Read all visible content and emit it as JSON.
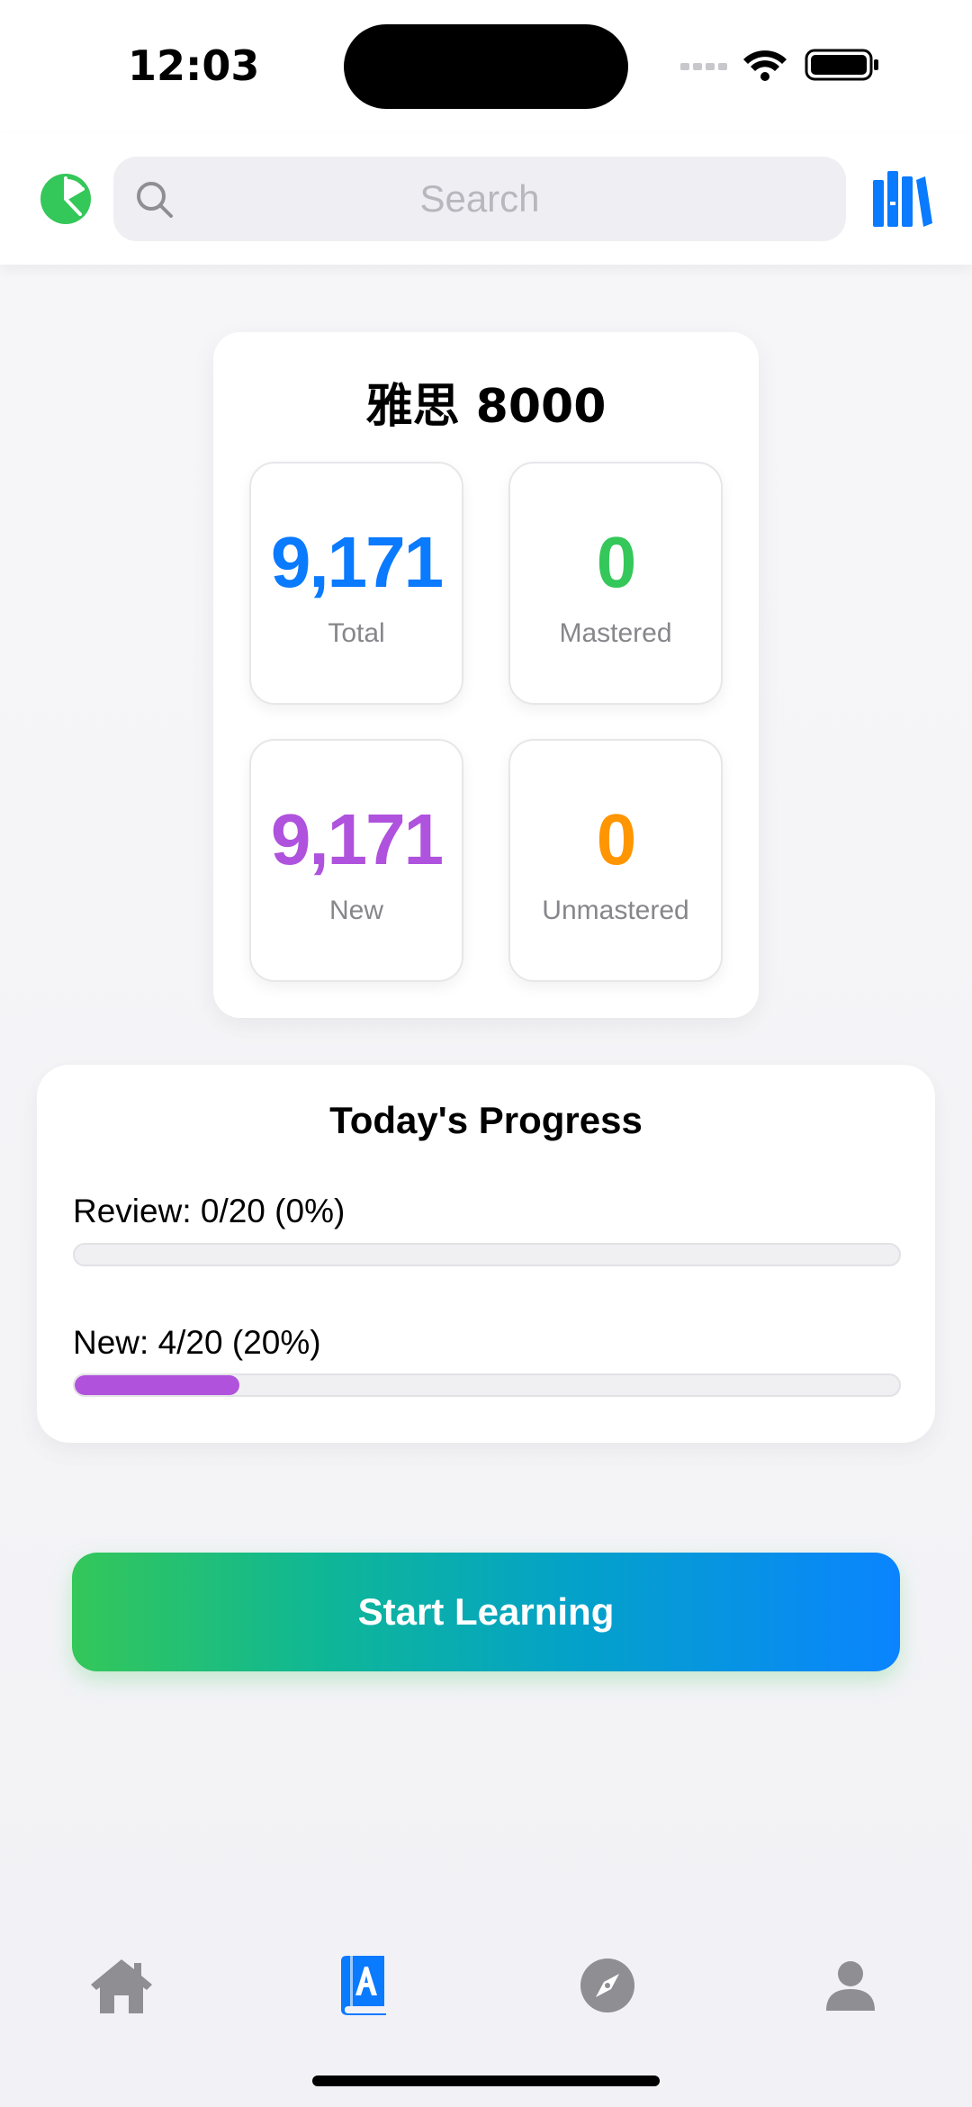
{
  "status_bar": {
    "time": "12:03"
  },
  "header": {
    "search_placeholder": "Search",
    "stats_icon": "pie-chart-icon",
    "library_icon": "books-icon"
  },
  "deck": {
    "title": "雅思 8000",
    "stats": [
      {
        "value": "9,171",
        "label": "Total",
        "color": "#0a7aff"
      },
      {
        "value": "0",
        "label": "Mastered",
        "color": "#34c759"
      },
      {
        "value": "9,171",
        "label": "New",
        "color": "#af52de"
      },
      {
        "value": "0",
        "label": "Unmastered",
        "color": "#ff9500"
      }
    ]
  },
  "progress": {
    "title": "Today's Progress",
    "review": {
      "label": "Review: 0/20 (0%)",
      "percent": 0
    },
    "new": {
      "label": "New: 4/20 (20%)",
      "percent": 20
    }
  },
  "start_button": {
    "label": "Start Learning"
  },
  "tab_bar": {
    "tabs": [
      {
        "name": "home",
        "icon": "house-icon",
        "active": false
      },
      {
        "name": "learn",
        "icon": "book-icon",
        "active": true
      },
      {
        "name": "explore",
        "icon": "compass-icon",
        "active": false
      },
      {
        "name": "profile",
        "icon": "person-icon",
        "active": false
      }
    ]
  },
  "colors": {
    "accent_blue": "#0a7aff",
    "accent_green": "#34c759",
    "accent_purple": "#af52de",
    "accent_orange": "#ff9500",
    "inactive_gray": "#8e8e93"
  }
}
